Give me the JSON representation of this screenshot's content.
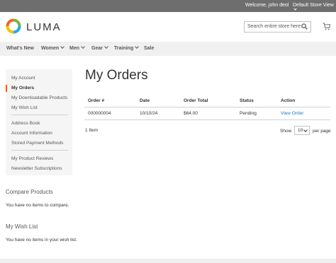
{
  "topbar": {
    "welcome": "Welcome, john deol",
    "store": "Default Store View"
  },
  "header": {
    "logo_text": "LUMA",
    "search_placeholder": "Search entire store here..."
  },
  "nav": {
    "items": [
      "What's New",
      "Women",
      "Men",
      "Gear",
      "Training",
      "Sale"
    ]
  },
  "sidebar": {
    "account_links": [
      "My Account",
      "My Orders",
      "My Downloadable Products",
      "My Wish List"
    ],
    "profile_links": [
      "Address Book",
      "Account Information",
      "Stored Payment Methods"
    ],
    "extra_links": [
      "My Product Reviews",
      "Newsletter Subscriptions"
    ],
    "active": "My Orders"
  },
  "compare": {
    "title": "Compare Products",
    "text": "You have no items to compare."
  },
  "wishlist": {
    "title": "My Wish List",
    "text": "You have no items in your wish list."
  },
  "main": {
    "title": "My Orders",
    "columns": [
      "Order #",
      "Date",
      "Order Total",
      "Status",
      "Action"
    ],
    "rows": [
      {
        "order": "000000004",
        "date": "10/10/24",
        "total": "$64.00",
        "status": "Pending",
        "action": "View Order"
      }
    ],
    "count": "1 Item",
    "show_label": "Show",
    "limiter_value": "10",
    "per_page": "per page"
  },
  "colors": {
    "accent": "#ff5501",
    "link": "#1979c3",
    "topbar": "#6e6e6e"
  }
}
